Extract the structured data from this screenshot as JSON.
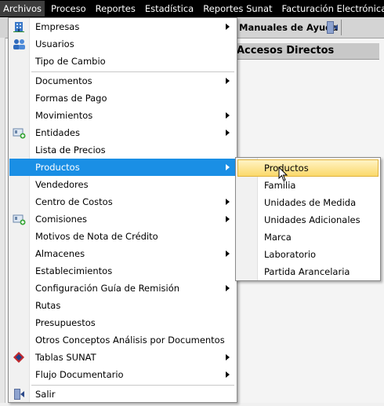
{
  "menubar": {
    "items": [
      {
        "label": "Archivos",
        "active": true
      },
      {
        "label": "Proceso"
      },
      {
        "label": "Reportes"
      },
      {
        "label": "Estadística"
      },
      {
        "label": "Reportes Sunat"
      },
      {
        "label": "Facturación Electrónica"
      }
    ]
  },
  "toolbar": {
    "manuales_label": "Manuales de Ayuda",
    "exit_icon": "exit-door-icon"
  },
  "panel": {
    "title": "Accesos Directos"
  },
  "archivos_menu": {
    "items": [
      {
        "label": "Empresas",
        "submenu": true,
        "icon": "building-icon"
      },
      {
        "label": "Usuarios",
        "icon": "users-icon"
      },
      {
        "label": "Tipo de Cambio"
      },
      {
        "label": "Documentos",
        "submenu": true
      },
      {
        "label": "Formas de Pago"
      },
      {
        "label": "Movimientos",
        "submenu": true
      },
      {
        "label": "Entidades",
        "submenu": true,
        "icon": "entity-card-icon"
      },
      {
        "label": "Lista de Precios"
      },
      {
        "label": "Productos",
        "submenu": true,
        "highlighted": true
      },
      {
        "label": "Vendedores"
      },
      {
        "label": "Centro de Costos",
        "submenu": true
      },
      {
        "label": "Comisiones",
        "submenu": true,
        "icon": "entity-card-icon"
      },
      {
        "label": "Motivos de Nota de Crédito"
      },
      {
        "label": "Almacenes",
        "submenu": true
      },
      {
        "label": "Establecimientos"
      },
      {
        "label": "Configuración Guía de Remisión",
        "submenu": true
      },
      {
        "label": "Rutas"
      },
      {
        "label": "Presupuestos"
      },
      {
        "label": "Otros Conceptos Análisis por Documentos"
      },
      {
        "label": "Tablas SUNAT",
        "submenu": true,
        "icon": "sunat-logo-icon"
      },
      {
        "label": "Flujo Documentario",
        "submenu": true
      },
      {
        "label": "Salir",
        "icon": "exit-door-icon"
      }
    ]
  },
  "productos_submenu": {
    "items": [
      {
        "label": "Productos",
        "highlighted": true
      },
      {
        "label": "Familia"
      },
      {
        "label": "Unidades de Medida"
      },
      {
        "label": "Unidades Adicionales"
      },
      {
        "label": "Marca"
      },
      {
        "label": "Laboratorio"
      },
      {
        "label": "Partida Arancelaria"
      }
    ]
  },
  "colors": {
    "menubar_bg": "#000000",
    "highlight_blue": "#1a8fe5",
    "submenu_highlight": "#fbd96b"
  }
}
